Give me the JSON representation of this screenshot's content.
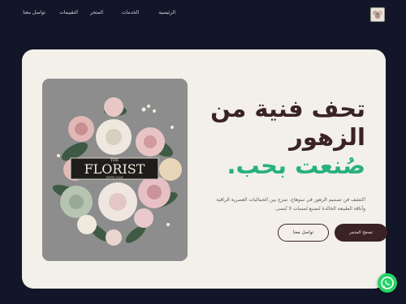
{
  "nav": {
    "items": [
      {
        "label": "الرئيسية"
      },
      {
        "label": "الخدمات"
      },
      {
        "label": "المتجر"
      },
      {
        "label": "التقييمات"
      },
      {
        "label": "تواصل معنا"
      }
    ]
  },
  "logo": {
    "icon": "store-logo-icon"
  },
  "hero": {
    "headline_line1": "تحف فنية من",
    "headline_line2": "الزهور",
    "headline_line3": "صُنعت بحب.",
    "description": "اكتشف فن تصميم الزهور في سوهاج. نمزج بين الجماليات العصرية الراقية وأناقة الطبيعة الخالدة لنصنع لمسات لا تُنسى.",
    "primary_button": "تصفح المتجر",
    "secondary_button": "تواصل معنا",
    "image": {
      "brand_top": "THE",
      "brand_name": "FLORIST",
      "brand_sub": "ESTD 2024"
    }
  },
  "colors": {
    "background": "#121628",
    "card": "#f3f0ea",
    "headline": "#3a2423",
    "accent": "#27b07f",
    "primary_button": "#3b2323",
    "whatsapp": "#25d366"
  },
  "whatsapp": {
    "icon": "whatsapp-icon"
  }
}
